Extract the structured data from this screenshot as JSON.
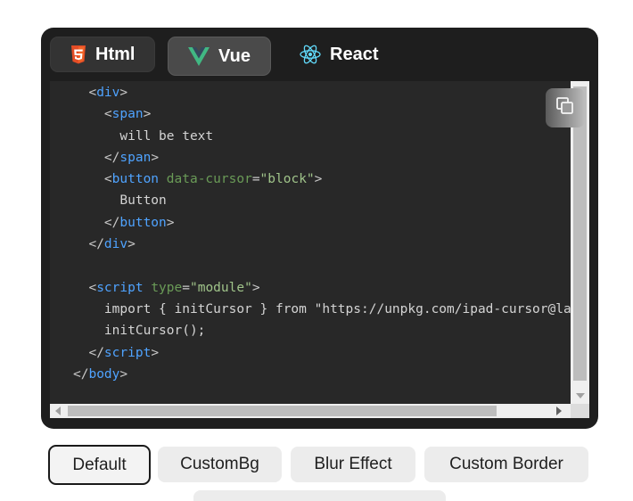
{
  "tabs": [
    {
      "id": "html",
      "label": "Html",
      "icon": "html5-icon",
      "color": "#e44d26"
    },
    {
      "id": "vue",
      "label": "Vue",
      "icon": "vue-icon",
      "color": "#41b883",
      "active": true
    },
    {
      "id": "react",
      "label": "React",
      "icon": "react-icon",
      "color": "#61dafb"
    }
  ],
  "code": {
    "lines": [
      [
        {
          "t": "punc",
          "v": "  <"
        },
        {
          "t": "tag",
          "v": "div"
        },
        {
          "t": "punc",
          "v": ">"
        }
      ],
      [
        {
          "t": "punc",
          "v": "    <"
        },
        {
          "t": "tag",
          "v": "span"
        },
        {
          "t": "punc",
          "v": ">"
        }
      ],
      [
        {
          "t": "text",
          "v": "      will be text"
        }
      ],
      [
        {
          "t": "punc",
          "v": "    </"
        },
        {
          "t": "tag",
          "v": "span"
        },
        {
          "t": "punc",
          "v": ">"
        }
      ],
      [
        {
          "t": "punc",
          "v": "    <"
        },
        {
          "t": "tag",
          "v": "button"
        },
        {
          "t": "text",
          "v": " "
        },
        {
          "t": "attr",
          "v": "data-cursor"
        },
        {
          "t": "punc",
          "v": "="
        },
        {
          "t": "str",
          "v": "\"block\""
        },
        {
          "t": "punc",
          "v": ">"
        }
      ],
      [
        {
          "t": "text",
          "v": "      Button"
        }
      ],
      [
        {
          "t": "punc",
          "v": "    </"
        },
        {
          "t": "tag",
          "v": "button"
        },
        {
          "t": "punc",
          "v": ">"
        }
      ],
      [
        {
          "t": "punc",
          "v": "  </"
        },
        {
          "t": "tag",
          "v": "div"
        },
        {
          "t": "punc",
          "v": ">"
        }
      ],
      [
        {
          "t": "text",
          "v": ""
        }
      ],
      [
        {
          "t": "punc",
          "v": "  <"
        },
        {
          "t": "tag",
          "v": "script"
        },
        {
          "t": "text",
          "v": " "
        },
        {
          "t": "attr",
          "v": "type"
        },
        {
          "t": "punc",
          "v": "="
        },
        {
          "t": "str",
          "v": "\"module\""
        },
        {
          "t": "punc",
          "v": ">"
        }
      ],
      [
        {
          "t": "text",
          "v": "    import { initCursor } from \"https://unpkg.com/ipad-cursor@latest\""
        }
      ],
      [
        {
          "t": "text",
          "v": "    initCursor();"
        }
      ],
      [
        {
          "t": "punc",
          "v": "  </"
        },
        {
          "t": "tag",
          "v": "script"
        },
        {
          "t": "punc",
          "v": ">"
        }
      ],
      [
        {
          "t": "punc",
          "v": "</"
        },
        {
          "t": "tag",
          "v": "body"
        },
        {
          "t": "punc",
          "v": ">"
        }
      ]
    ]
  },
  "copy_button": {
    "icon": "copy-icon"
  },
  "options": [
    {
      "id": "default",
      "label": "Default",
      "selected": true
    },
    {
      "id": "custombg",
      "label": "CustomBg"
    },
    {
      "id": "blur",
      "label": "Blur Effect"
    },
    {
      "id": "border",
      "label": "Custom Border"
    }
  ],
  "colors": {
    "window_bg": "#1e1e1e",
    "code_bg": "#282828",
    "tag": "#4fa3ff",
    "attr": "#6a9b57",
    "string": "#a0c48a"
  }
}
